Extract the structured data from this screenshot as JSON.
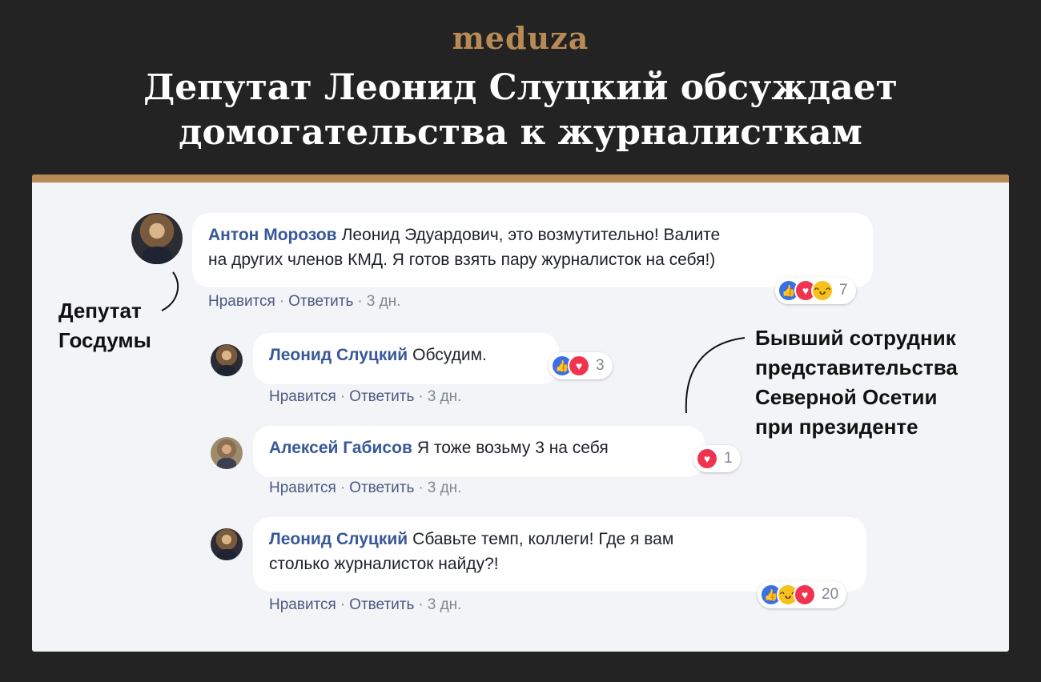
{
  "brand": {
    "logo": "meduza",
    "accent": "#b88a56"
  },
  "headline": {
    "line1": "Депутат Леонид Слуцкий обсуждает",
    "line2": "домогательства к журналисткам"
  },
  "comments": [
    {
      "author": "Антон Морозов",
      "text_line1": "Леонид Эдуардович, это возмутительно! Валите",
      "text_line2": "на других членов КМД. Я готов взять пару журналисток на себя!)",
      "like": "Нравится",
      "reply": "Ответить",
      "sep": "·",
      "time": "3 дн.",
      "reactions": [
        "like-icon",
        "love-icon",
        "haha-icon"
      ],
      "reaction_count": "7"
    },
    {
      "author": "Леонид Слуцкий",
      "text": "Обсудим.",
      "like": "Нравится",
      "reply": "Ответить",
      "sep": "·",
      "time": "3 дн.",
      "reactions": [
        "like-icon",
        "love-icon"
      ],
      "reaction_count": "3"
    },
    {
      "author": "Алексей Габисов",
      "text": "Я тоже возьму 3 на себя",
      "like": "Нравится",
      "reply": "Ответить",
      "sep": "·",
      "time": "3 дн.",
      "reactions": [
        "love-icon"
      ],
      "reaction_count": "1"
    },
    {
      "author": "Леонид Слуцкий",
      "text_line1": "Сбавьте темп, коллеги! Где я вам",
      "text_line2": "столько журналисток найду?!",
      "like": "Нравится",
      "reply": "Ответить",
      "sep": "·",
      "time": "3 дн.",
      "reactions": [
        "like-icon",
        "haha-icon",
        "love-icon"
      ],
      "reaction_count": "20"
    }
  ],
  "annotations": {
    "left_line1": "Депутат",
    "left_line2": "Госдумы",
    "right_line1": "Бывший сотрудник",
    "right_line2": "представительства",
    "right_line3": "Северной Осетии",
    "right_line4": "при президенте"
  },
  "colors": {
    "author": "#385898",
    "card": "#f3f4f7",
    "like": "#3b6fe6",
    "love": "#f0344f",
    "haha": "#f7c21d"
  }
}
